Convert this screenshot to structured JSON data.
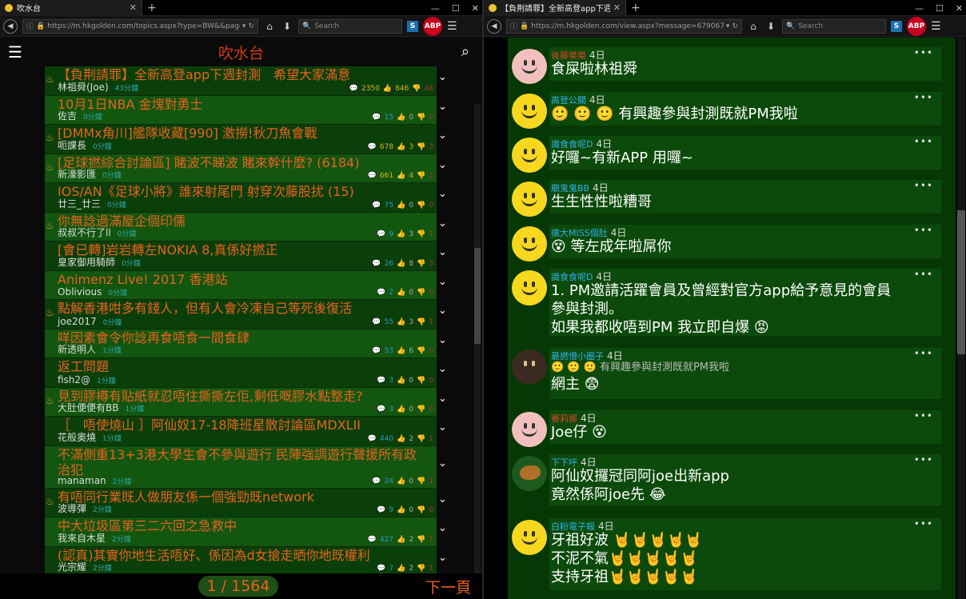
{
  "left": {
    "tab_title": "吹水台",
    "url": "https://m.hkgolden.com/topics.aspx?type=BW&&page=1",
    "search_placeholder": "Search",
    "site_title": "吹水台",
    "topics": [
      {
        "title": "【負荆請罪】全新高登app下週封測　希望大家滿意",
        "author": "林祖舜(Joe)",
        "time": "43分鐘",
        "replies": "2350",
        "likes": "846",
        "dislikes": "46",
        "hot": true
      },
      {
        "title": "10月1日NBA 金塊對勇士",
        "author": "佐吉",
        "time": "0分鐘",
        "replies": "15",
        "likes": "0",
        "dislikes": "0",
        "hot": false
      },
      {
        "title": "[DMMx角川]艦隊收藏[990] 激撈!秋刀魚會戰",
        "author": "呃課長",
        "time": "0分鐘",
        "replies": "678",
        "likes": "3",
        "dislikes": "3",
        "hot": true
      },
      {
        "title": "[足球撚綜合討論區] 賭波不睇波 賭來幹什麼? (6184)",
        "author": "新濠影匯",
        "time": "0分鐘",
        "replies": "661",
        "likes": "4",
        "dislikes": "2",
        "hot": true
      },
      {
        "title": "IOS/AN《足球小將》誰來射尾門 射穿次藤股扰 (15)",
        "author": "廿三_廿三",
        "time": "0分鐘",
        "replies": "75",
        "likes": "0",
        "dislikes": "0",
        "hot": false
      },
      {
        "title": "你無諗過滿屋企個印儒",
        "author": "叔叔不行了ll",
        "time": "0分鐘",
        "replies": "9",
        "likes": "3",
        "dislikes": "1",
        "hot": false
      },
      {
        "title": "[會已轉]岩岩轉左NOKIA 8,真係好撚正",
        "author": "皇家御用騎師",
        "time": "0分鐘",
        "replies": "26",
        "likes": "8",
        "dislikes": "3",
        "hot": false
      },
      {
        "title": "Animenz Live! 2017 香港站",
        "author": "Oblivious",
        "time": "0分鐘",
        "replies": "2",
        "likes": "0",
        "dislikes": "0",
        "hot": false
      },
      {
        "title": "點解香港咁多有錢人，但有人會冷凍自己等死後復活",
        "author": "joe2017",
        "time": "0分鐘",
        "replies": "55",
        "likes": "3",
        "dislikes": "1",
        "hot": false
      },
      {
        "title": "咩因素會令你諗再食唔食一間食肆",
        "author": "新透明人",
        "time": "1分鐘",
        "replies": "53",
        "likes": "6",
        "dislikes": "0",
        "hot": false
      },
      {
        "title": "返工問題",
        "author": "fish2@",
        "time": "1分鐘",
        "replies": "3",
        "likes": "0",
        "dislikes": "0",
        "hot": false
      },
      {
        "title": "見到膠樽有貼紙就忍唔住撕撕左佢,剩低嘅膠水點整走?",
        "author": "大肚便便有BB",
        "time": "1分鐘",
        "replies": "3",
        "likes": "0",
        "dislikes": "0",
        "hot": false
      },
      {
        "title": "［　唔使燒山 ］阿仙奴17-18降班星散討論區MDXLII",
        "author": "花般奧燒",
        "time": "1分鐘",
        "replies": "440",
        "likes": "2",
        "dislikes": "1",
        "hot": false
      },
      {
        "title": "不滿側重13+3港大學生會不參與遊行 民陣強調遊行聲援所有政治犯",
        "author": "manaman",
        "time": "2分鐘",
        "replies": "24",
        "likes": "0",
        "dislikes": "1",
        "hot": false
      },
      {
        "title": "有唔同行業既人做朋友係一個強勁既network",
        "author": "波導彈",
        "time": "2分鐘",
        "replies": "9",
        "likes": "0",
        "dislikes": "0",
        "hot": false
      },
      {
        "title": "中大垃圾區第三二六回之急救中",
        "author": "我來自木星",
        "time": "2分鐘",
        "replies": "427",
        "likes": "2",
        "dislikes": "1",
        "hot": false
      },
      {
        "title": "(認真)其實你地生活唔好、係因為d女搶走晒你地既權利",
        "author": "光宗耀",
        "time": "2分鐘",
        "replies": "7",
        "likes": "2",
        "dislikes": "1",
        "hot": false
      }
    ],
    "pager_text": "1 / 1564",
    "next_text": "下一頁"
  },
  "right": {
    "tab_title": "【負荆請罪】全新高登app下週封測　...",
    "url": "https://m.hkgolden.com/view.aspx?message=6790677&type=",
    "search_placeholder": "Search",
    "posts": [
      {
        "name": "後藤樂樂",
        "ago": "4日",
        "name_color": "#d0462a",
        "avatar": "pink",
        "lines": [
          "食屎啦林祖舜"
        ]
      },
      {
        "name": "高登公關",
        "ago": "4日",
        "name_color": "#2eb1e6",
        "avatar": "yel",
        "lines": [
          "🙂 🙂 🙂 有興趣參與封測既就PM我啦"
        ]
      },
      {
        "name": "識食食呢D",
        "ago": "4日",
        "name_color": "#2eb1e6",
        "avatar": "yel",
        "lines": [
          "好囉~有新APP 用囉~"
        ]
      },
      {
        "name": "廟鬼鬼BB",
        "ago": "4日",
        "name_color": "#2eb1e6",
        "avatar": "yel",
        "lines": [
          "生生性性啦糟哥"
        ]
      },
      {
        "name": "擒大MISS個肚",
        "ago": "4日",
        "name_color": "#2eb1e6",
        "avatar": "yel",
        "lines": [
          "😵 等左成年啦屌你"
        ]
      },
      {
        "name": "識食食呢D",
        "ago": "4日",
        "name_color": "#2eb1e6",
        "avatar": "yel",
        "lines": [
          "1. PM邀請活躍會員及曾經對官方app給予意見的會員",
          "參與封測。",
          "如果我都收唔到PM 我立即自爆 😡"
        ]
      },
      {
        "name": "最撚憎小圈子",
        "ago": "4日",
        "name_color": "#2eb1e6",
        "avatar": "img",
        "quote": "🙂 🙂 🙂 有興趣參與封測既就PM我啦",
        "lines": [
          "網主 😨"
        ]
      },
      {
        "name": "賽莉娜",
        "ago": "4日",
        "name_color": "#d0462a",
        "avatar": "pink",
        "lines": [
          "Joe仔 😵"
        ]
      },
      {
        "name": "下下呼",
        "ago": "4日",
        "name_color": "#2eb1e6",
        "avatar": "bird",
        "lines": [
          "阿仙奴攞冠同阿joe出新app",
          "竟然係阿joe先 😂"
        ]
      },
      {
        "name": "白粉電子報",
        "ago": "4日",
        "name_color": "#2eb1e6",
        "avatar": "yel",
        "lines": [
          "牙祖好波 🤘🤘🤘🤘🤘",
          "不泥不氣🤘🤘🤘🤘🤘",
          "支持牙祖🤘🤘🤘🤘🤘"
        ]
      }
    ]
  }
}
